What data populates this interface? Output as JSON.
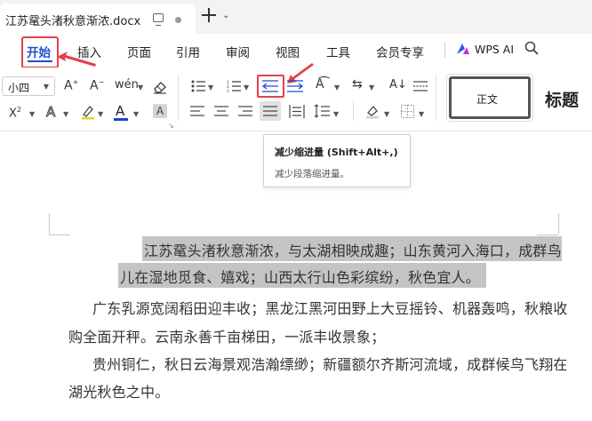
{
  "tab": {
    "title": "江苏鼋头渚秋意渐浓.docx"
  },
  "menu": {
    "items": [
      "开始",
      "插入",
      "页面",
      "引用",
      "审阅",
      "视图",
      "工具",
      "会员专享"
    ],
    "ai_label": "WPS AI"
  },
  "toolbar": {
    "font_size": "小四",
    "style_normal": "正文",
    "style_heading": "标题"
  },
  "tooltip": {
    "title": "减少缩进量 (Shift+Alt+,)",
    "description": "减少段落缩进量。"
  },
  "document": {
    "para1_line1": "江苏鼋头渚秋意渐浓，与太湖相映成趣；山东黄河入海口，成群鸟",
    "para1_line2": "儿在湿地觅食、嬉戏；山西太行山色彩缤纷，秋色宜人。",
    "para2_line1": "广东乳源宽阔稻田迎丰收；黑龙江黑河田野上大豆摇铃、机器轰鸣，秋粮收",
    "para2_line2": "购全面开秤。云南永善千亩梯田，一派丰收景象；",
    "para3_line1": "贵州铜仁，秋日云海景观浩瀚缥缈；新疆额尔齐斯河流域，成群候鸟飞翔在",
    "para3_line2": "湖光秋色之中。"
  },
  "colors": {
    "accent": "#1f4ecb",
    "annotation_red": "#e5414c",
    "highlight": "#c4c4c4"
  }
}
